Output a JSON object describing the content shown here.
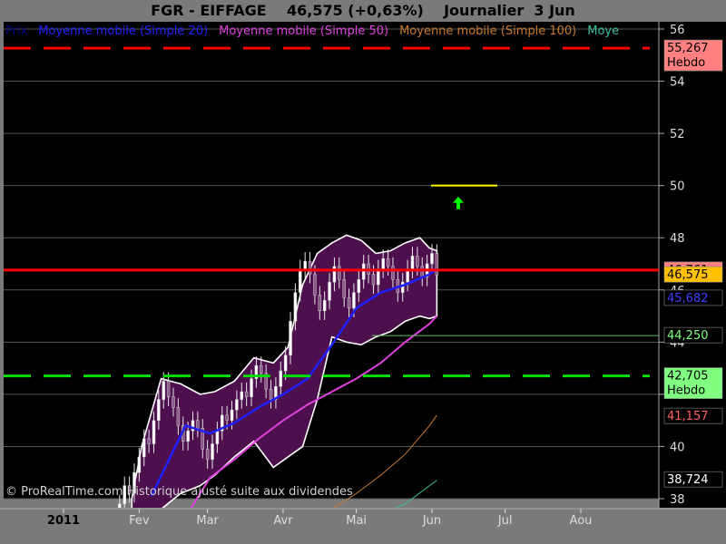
{
  "header": {
    "title": "FGR - EIFFAGE    46,575 (+0,63%)    Journalier  3 Jun"
  },
  "legend": [
    {
      "label": "Prix",
      "color": "#000080"
    },
    {
      "label": "Moyenne mobile (Simple 20)",
      "color": "#2020ff"
    },
    {
      "label": "Moyenne mobile (Simple 50)",
      "color": "#e040e0"
    },
    {
      "label": "Moyenne mobile (Simple 100)",
      "color": "#c87830"
    },
    {
      "label": "Moye",
      "color": "#40c0a0"
    }
  ],
  "copyright": "© ProRealTime.com Historique ajusté suite aux dividendes",
  "colors": {
    "background": "#000000",
    "band_fill": "#4d0f4d",
    "band_edge": "#ffffff",
    "resistance": "#ff0000",
    "support": "#00e000",
    "price_line": "#ff0000",
    "ma20": "#2020ff",
    "ma50": "#e040e0",
    "ma100": "#c87830",
    "ma_long": "#40c0a0",
    "target": "#ffff00",
    "arrow": "#00ff00"
  },
  "tags": [
    {
      "value": "55,267",
      "sub": "Hebdo",
      "bg": "#ff8080",
      "fg": "#000000"
    },
    {
      "value": "46,761",
      "sub": "",
      "bg": "#ff8080",
      "fg": "#000000"
    },
    {
      "value": "46,575",
      "sub": "",
      "bg": "#ffc000",
      "fg": "#000000"
    },
    {
      "value": "45,682",
      "sub": "",
      "bg": "#000000",
      "fg": "#4040ff"
    },
    {
      "value": "44,250",
      "sub": "",
      "bg": "#000000",
      "fg": "#80ff80"
    },
    {
      "value": "42,705",
      "sub": "Hebdo",
      "bg": "#80ff80",
      "fg": "#000000"
    },
    {
      "value": "41,157",
      "sub": "",
      "bg": "#000000",
      "fg": "#ff6060"
    },
    {
      "value": "38,724",
      "sub": "",
      "bg": "#000000",
      "fg": "#ffffff"
    }
  ],
  "chart_data": {
    "type": "line",
    "ylim": [
      38,
      56
    ],
    "y_ticks": [
      "38",
      "40",
      "42",
      "44",
      "46",
      "48",
      "50",
      "52",
      "54",
      "56"
    ],
    "x_ticks": [
      "2011",
      "Fev",
      "Mar",
      "Avr",
      "Mai",
      "Jun",
      "Jul",
      "Aou"
    ],
    "x_tick_days": [
      0,
      31,
      59,
      90,
      120,
      151,
      181,
      212
    ],
    "last_price": 46.575,
    "levels": [
      {
        "name": "resistance-hebdo",
        "value": 55.267,
        "style": "dashed"
      },
      {
        "name": "last-price",
        "value": 46.761,
        "style": "solid"
      },
      {
        "name": "support-hebdo",
        "value": 42.705,
        "style": "dashed"
      },
      {
        "name": "target",
        "value": 50.0,
        "style": "short"
      }
    ],
    "price": {
      "days": [
        21,
        23,
        25,
        27,
        29,
        31,
        33,
        35,
        37,
        39,
        41,
        43,
        45,
        47,
        49,
        51,
        53,
        55,
        57,
        59,
        61,
        63,
        65,
        67,
        69,
        71,
        73,
        75,
        77,
        79,
        81,
        83,
        85,
        87,
        89,
        91,
        93,
        95,
        97,
        99,
        101,
        103,
        105,
        107,
        109,
        111,
        113,
        115,
        117,
        119,
        121,
        123,
        125,
        127,
        129,
        131,
        133,
        135,
        137,
        139,
        141,
        143,
        145,
        147,
        149,
        151,
        153
      ],
      "close": [
        37.2,
        37.8,
        38.5,
        38.2,
        39.0,
        39.6,
        40.3,
        40.1,
        41.0,
        41.8,
        42.5,
        41.9,
        41.5,
        40.8,
        40.2,
        40.6,
        41.0,
        40.7,
        39.9,
        39.5,
        40.1,
        40.6,
        41.2,
        41.0,
        41.4,
        41.8,
        42.1,
        41.9,
        42.6,
        43.1,
        42.8,
        42.2,
        41.8,
        42.3,
        42.9,
        43.5,
        44.8,
        45.9,
        46.8,
        47.1,
        46.6,
        45.8,
        45.2,
        45.6,
        46.3,
        46.9,
        46.4,
        45.7,
        45.3,
        45.9,
        46.4,
        47.0,
        46.6,
        46.2,
        46.8,
        47.2,
        46.9,
        46.4,
        45.9,
        46.3,
        46.8,
        47.3,
        46.9,
        46.5,
        47.0,
        47.4,
        46.575
      ]
    },
    "series": [
      {
        "name": "Moyenne mobile (Simple 20)",
        "days": [
          36,
          50,
          60,
          70,
          80,
          90,
          100,
          110,
          120,
          130,
          140,
          150,
          153
        ],
        "values": [
          38.1,
          40.8,
          40.5,
          40.9,
          41.5,
          42.0,
          42.6,
          43.9,
          45.3,
          45.9,
          46.2,
          46.6,
          46.8
        ]
      },
      {
        "name": "Moyenne mobile (Simple 50)",
        "days": [
          52,
          60,
          70,
          80,
          90,
          100,
          110,
          120,
          130,
          140,
          150,
          153
        ],
        "values": [
          37.6,
          38.8,
          39.5,
          40.3,
          41.0,
          41.6,
          42.1,
          42.6,
          43.2,
          44.0,
          44.7,
          45.0
        ]
      },
      {
        "name": "Moyenne mobile (Simple 100)",
        "days": [
          98,
          110,
          120,
          130,
          140,
          150,
          153
        ],
        "values": [
          37.2,
          37.6,
          38.2,
          38.9,
          39.7,
          40.8,
          41.2
        ]
      },
      {
        "name": "Moye",
        "days": [
          118,
          130,
          140,
          150,
          153
        ],
        "values": [
          37.0,
          37.4,
          37.8,
          38.5,
          38.7
        ]
      }
    ],
    "bands": {
      "days": [
        28,
        32,
        40,
        48,
        56,
        62,
        70,
        78,
        86,
        92,
        98,
        104,
        110,
        116,
        122,
        128,
        134,
        140,
        146,
        150,
        153
      ],
      "upper": [
        38.0,
        40.0,
        42.6,
        42.4,
        42.0,
        42.1,
        42.5,
        43.4,
        43.2,
        43.8,
        46.2,
        47.4,
        47.8,
        48.1,
        47.9,
        47.4,
        47.5,
        47.8,
        48.0,
        47.6,
        47.5
      ],
      "lower": [
        37.0,
        37.0,
        37.6,
        38.2,
        38.5,
        38.9,
        39.6,
        40.2,
        39.2,
        39.6,
        40.0,
        41.8,
        44.2,
        44.0,
        43.9,
        44.2,
        44.4,
        44.8,
        45.0,
        44.9,
        45.0
      ]
    }
  }
}
